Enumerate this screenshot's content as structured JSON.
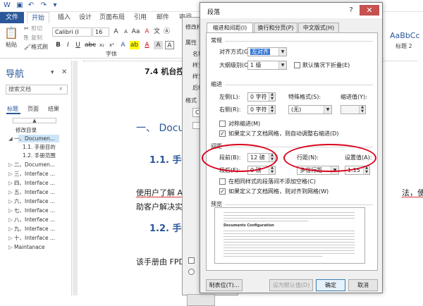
{
  "ribbon": {
    "tabs": [
      "文件",
      "开始",
      "插入",
      "设计",
      "页面布局",
      "引用",
      "邮件",
      "审阅"
    ],
    "paste_label": "粘贴",
    "cut_label": "剪切",
    "copy_label": "复制",
    "format_painter_label": "格式刷",
    "font_name": "Calibri (I",
    "font_size": "16",
    "font_group_label": "字体",
    "styles_peek_label": "AaBbCc",
    "styles_peek_sub": "标题 2"
  },
  "nav": {
    "title": "导航",
    "search_placeholder": "搜索文档",
    "tabs": [
      "标题",
      "页面",
      "结果"
    ],
    "items": [
      "修改目录",
      "一、Documen...",
      "1.1. 手册目的",
      "1.2. 手册范围",
      "二、Documen...",
      "三、Interface ...",
      "四、Interface ...",
      "五、Interface ...",
      "六、Interface ...",
      "七、Interface ...",
      "八、Interface ...",
      "九、Interface ...",
      "十、Interface ...",
      "Maintanace"
    ]
  },
  "doc": {
    "heading_74": "7.4 机台控制",
    "heading_1": "一、 Docu",
    "heading_11": "1.1. 手册",
    "body_line1": "使用户了解 A",
    "body_line1_tail": "法，使",
    "body_line2": "助客户解决实",
    "heading_12": "1.2. 手册",
    "body_line3": "该手册由 FPD"
  },
  "behind_dialog": {
    "title": "修改样",
    "labels": [
      "属性",
      "名称",
      "样式",
      "样式",
      "后续",
      "格式",
      "Ca"
    ]
  },
  "dialog": {
    "title": "段落",
    "tabs": [
      "缩进和间距(I)",
      "换行和分页(P)",
      "中文版式(H)"
    ],
    "general": {
      "section": "常规",
      "alignment_label": "对齐方式(G):",
      "alignment_value": "左对齐",
      "outline_label": "大纲级别(O):",
      "outline_value": "1 级",
      "collapsed_label": "默认情况下折叠(E)"
    },
    "indent": {
      "section": "缩进",
      "left_label": "左侧(L):",
      "left_value": "0 字符",
      "right_label": "右侧(R):",
      "right_value": "0 字符",
      "special_label": "特殊格式(S):",
      "special_value": "(无)",
      "indent_value_label": "缩进值(Y):",
      "mirror_label": "对称缩进(M)",
      "auto_adjust_label": "如果定义了文档网格，则自动调整右缩进(D)"
    },
    "spacing": {
      "section": "间距",
      "before_label": "段前(B):",
      "before_value": "12 磅",
      "after_label": "段后(F):",
      "after_value": "0 磅",
      "line_spacing_label": "行距(N):",
      "line_spacing_value": "多倍行距",
      "at_label": "设置值(A):",
      "at_value": "1.15",
      "no_space_label": "在相同样式的段落间不添加空格(C)",
      "snap_grid_label": "如果定义了文档网格，则对齐到网格(W)"
    },
    "preview": {
      "section": "预览",
      "sample_text": "Documents Configuration"
    },
    "buttons": {
      "tabs": "制表位(T)...",
      "set_default": "设为默认值(D)",
      "ok": "确定",
      "cancel": "取消"
    }
  }
}
